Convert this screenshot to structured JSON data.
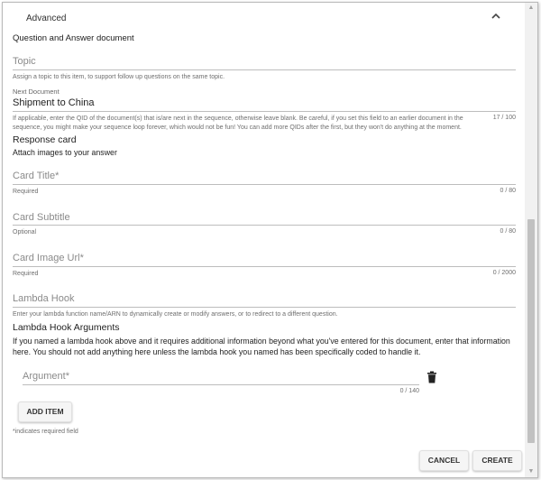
{
  "section": {
    "title": "Advanced"
  },
  "doc_type_label": "Question and Answer document",
  "topic": {
    "placeholder": "Topic",
    "helper": "Assign a topic to this item, to support follow up questions on the same topic."
  },
  "next_document": {
    "label": "Next Document",
    "value": "Shipment to China",
    "helper_line1": "If applicable, enter the QID of the document(s) that is/are next in the sequence, otherwise leave blank. Be careful, if you set this field to an earlier document in the",
    "helper_line2": "sequence, you might make your sequence loop forever, which would not be fun! You can add more QIDs after the first, but they won't do anything at the moment.",
    "counter": "17 / 100"
  },
  "response_card": {
    "title": "Response card",
    "subtitle": "Attach images to your answer"
  },
  "card_title": {
    "placeholder": "Card Title*",
    "helper": "Required",
    "counter": "0 / 80"
  },
  "card_subtitle": {
    "placeholder": "Card Subtitle",
    "helper": "Optional",
    "counter": "0 / 80"
  },
  "card_image_url": {
    "placeholder": "Card Image Url*",
    "helper": "Required",
    "counter": "0 / 2000"
  },
  "lambda_hook": {
    "placeholder": "Lambda Hook",
    "helper": "Enter your lambda function name/ARN to dynamically create or modify answers, or to redirect to a different question."
  },
  "lambda_args": {
    "title": "Lambda Hook Arguments",
    "desc_line1": "If you named a lambda hook above and it requires additional information beyond what you've entered for this document, enter that information",
    "desc_line2": "here. You should not add anything here unless the lambda hook you named has been specifically coded to handle it."
  },
  "argument": {
    "placeholder": "Argument*",
    "counter": "0 / 140"
  },
  "add_item_label": "ADD ITEM",
  "required_note": "*indicates required field",
  "cancel_label": "CANCEL",
  "create_label": "CREATE"
}
